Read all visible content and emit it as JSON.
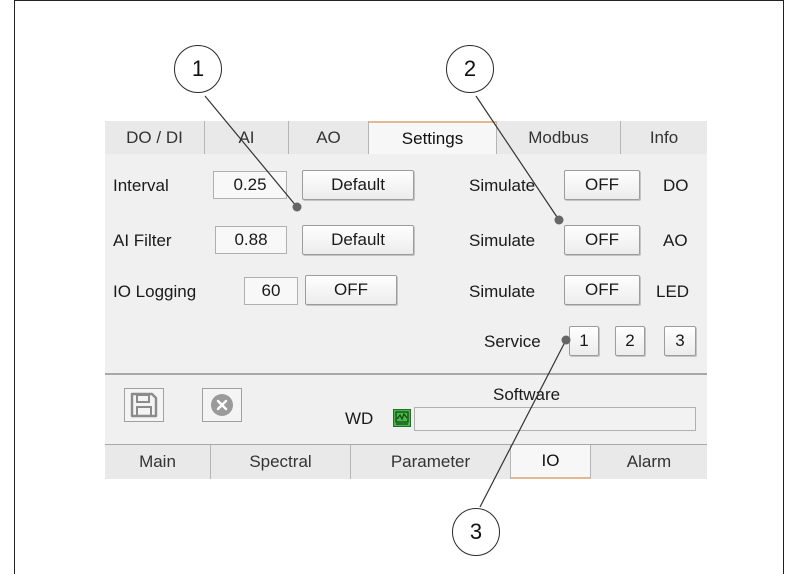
{
  "tabs_top": [
    {
      "label": "DO / DI",
      "active": false
    },
    {
      "label": "AI",
      "active": false
    },
    {
      "label": "AO",
      "active": false
    },
    {
      "label": "Settings",
      "active": true
    },
    {
      "label": "Modbus",
      "active": false
    },
    {
      "label": "Info",
      "active": false
    }
  ],
  "settings": {
    "interval": {
      "label": "Interval",
      "value": "0.25",
      "button": "Default"
    },
    "ai_filter": {
      "label": "AI Filter",
      "value": "0.88",
      "button": "Default"
    },
    "io_logging": {
      "label": "IO Logging",
      "value": "60",
      "button": "OFF"
    },
    "simulate": [
      {
        "label": "Simulate",
        "state": "OFF",
        "target": "DO"
      },
      {
        "label": "Simulate",
        "state": "OFF",
        "target": "AO"
      },
      {
        "label": "Simulate",
        "state": "OFF",
        "target": "LED"
      }
    ],
    "service": {
      "label": "Service",
      "buttons": [
        "1",
        "2",
        "3"
      ]
    }
  },
  "footer": {
    "software_label": "Software",
    "wd_label": "WD",
    "icons": [
      "save-icon",
      "cancel-icon",
      "watchdog-icon"
    ]
  },
  "tabs_bottom": [
    {
      "label": "Main",
      "active": false
    },
    {
      "label": "Spectral",
      "active": false
    },
    {
      "label": "Parameter",
      "active": false
    },
    {
      "label": "IO",
      "active": true
    },
    {
      "label": "Alarm",
      "active": false
    }
  ],
  "callouts": [
    "1",
    "2",
    "3"
  ],
  "colors": {
    "active_tab_accent": "#e4b98f",
    "watchdog_green": "#3fbf3f"
  }
}
